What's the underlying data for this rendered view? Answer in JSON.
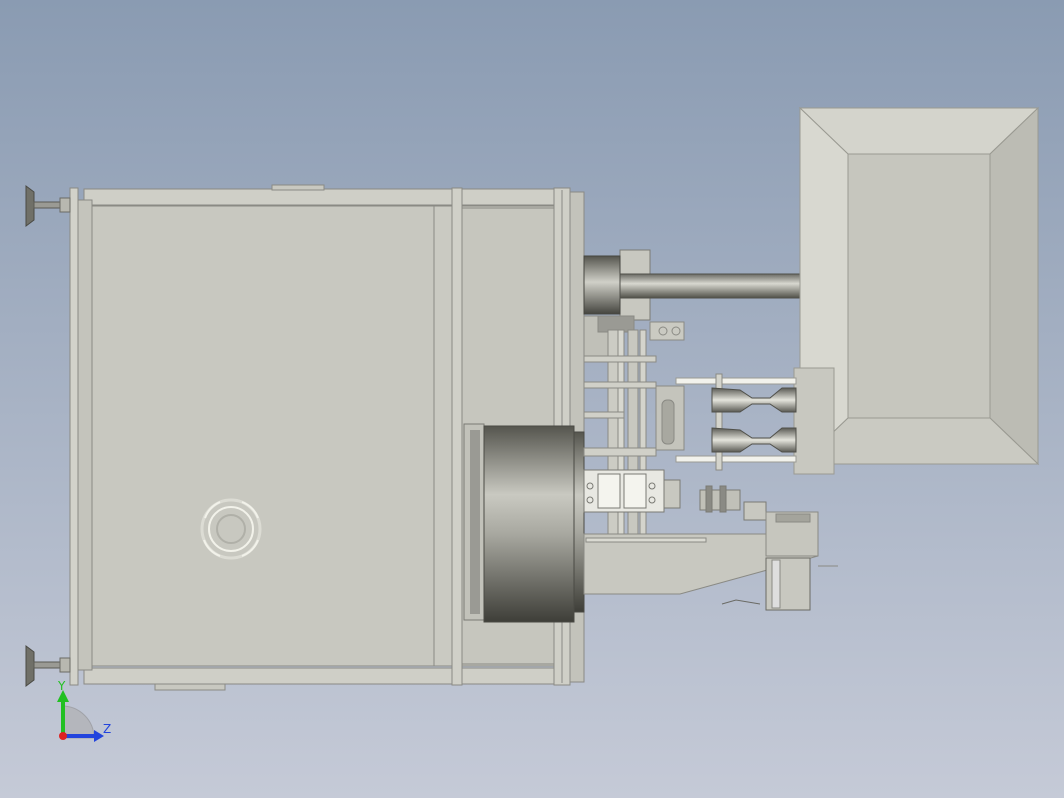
{
  "viewport": {
    "background_top": "#8c9db4",
    "background_bottom": "#c4c9d6"
  },
  "model": {
    "part_fill": "#c8c8c0",
    "part_stroke": "#8a8a84",
    "edge_light": "#e8e8e0",
    "edge_dark": "#6a6a64",
    "shade_dark": "#4a4a44"
  },
  "triad": {
    "y_label": "Y",
    "z_label": "Z",
    "y_color": "#22c022",
    "z_color": "#2244dd",
    "x_color": "#dd2222"
  }
}
